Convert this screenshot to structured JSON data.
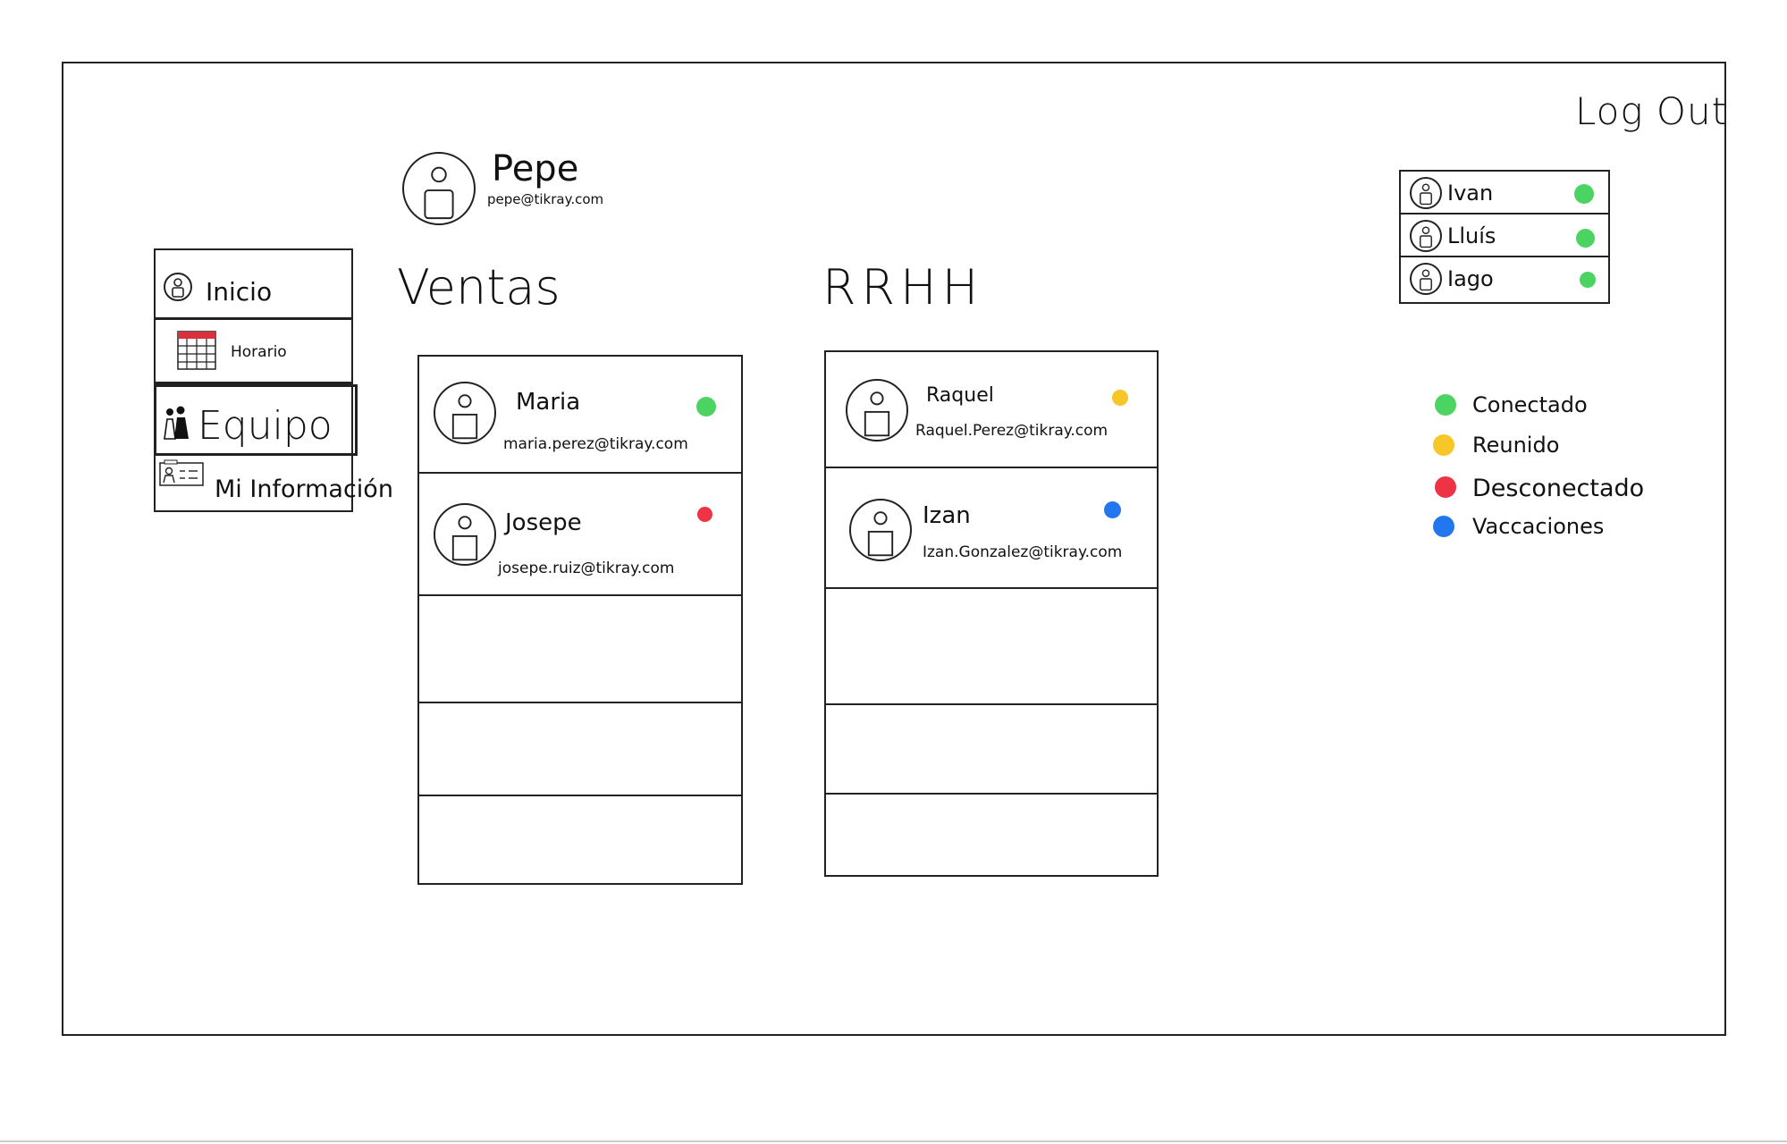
{
  "header": {
    "logout_label": "Log Out"
  },
  "user": {
    "name": "Pepe",
    "email": "pepe@tikray.com"
  },
  "sidebar": {
    "items": [
      {
        "label": "Inicio",
        "icon": "user-icon"
      },
      {
        "label": "Horario",
        "icon": "calendar-icon"
      },
      {
        "label": "Equipo",
        "icon": "team-icon",
        "selected": true
      },
      {
        "label": "Mi Información",
        "icon": "id-card-icon"
      }
    ]
  },
  "departments": [
    {
      "title": "Ventas",
      "members": [
        {
          "name": "Maria",
          "email": "maria.perez@tikray.com",
          "status_color": "#4cd462"
        },
        {
          "name": "Josepe",
          "email": "josepe.ruiz@tikray.com",
          "status_color": "#ee3344"
        }
      ]
    },
    {
      "title": "RRHH",
      "members": [
        {
          "name": "Raquel",
          "email": "Raquel.Perez@tikray.com",
          "status_color": "#f7c628"
        },
        {
          "name": "Izan",
          "email": "Izan.Gonzalez@tikray.com",
          "status_color": "#2277ee"
        }
      ]
    }
  ],
  "online": [
    {
      "name": "Ivan",
      "status_color": "#4cd462"
    },
    {
      "name": "Lluís",
      "status_color": "#4cd462"
    },
    {
      "name": "Iago",
      "status_color": "#4cd462"
    }
  ],
  "legend": [
    {
      "label": "Conectado",
      "color": "#4cd462"
    },
    {
      "label": "Reunido",
      "color": "#f7c628"
    },
    {
      "label": "Desconectado",
      "color": "#ee3344"
    },
    {
      "label": "Vaccaciones",
      "color": "#2277ee"
    }
  ]
}
